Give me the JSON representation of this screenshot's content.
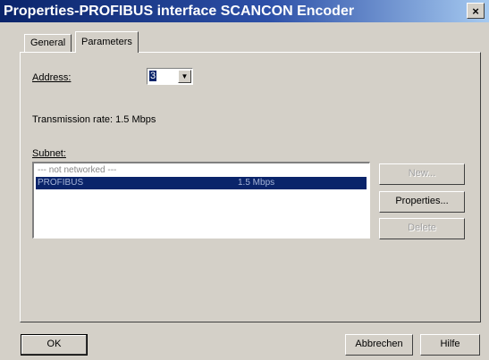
{
  "window": {
    "title": "Properties-PROFIBUS interface SCANCON Encoder",
    "close_glyph": "×"
  },
  "tabs": [
    {
      "label": "General",
      "active": false
    },
    {
      "label": "Parameters",
      "active": true
    }
  ],
  "address": {
    "label": "Address:",
    "value": "3"
  },
  "transmission_rate": "Transmission rate: 1.5 Mbps",
  "subnet": {
    "label": "Subnet:",
    "items": [
      {
        "name": "--- not networked ---",
        "rate": "",
        "selected": false
      },
      {
        "name": "PROFIBUS",
        "rate": "1.5 Mbps",
        "selected": true
      }
    ]
  },
  "buttons": {
    "new": "New...",
    "properties": "Properties...",
    "delete": "Delete",
    "ok": "OK",
    "cancel": "Abbrechen",
    "help": "Hilfe"
  },
  "colors": {
    "title_bar_start": "#0a246a",
    "title_bar_end": "#a6caf0",
    "selection": "#0a246a",
    "face": "#d4d0c8"
  }
}
